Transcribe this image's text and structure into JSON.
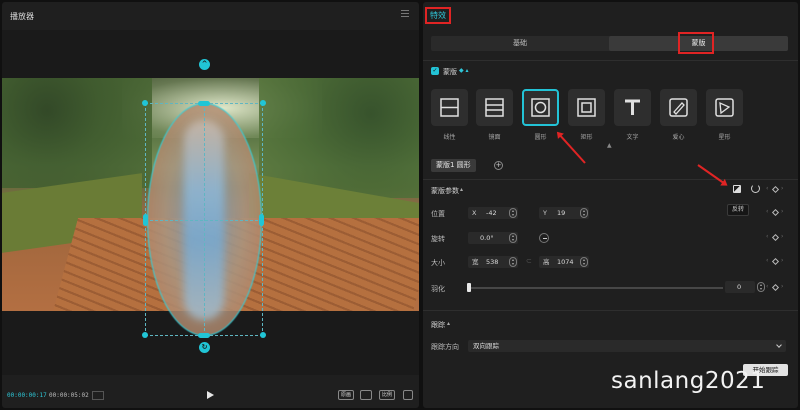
{
  "player": {
    "title": "播放器",
    "current_time": "00:00:00:17",
    "total_time": "00:00:05:02",
    "btn_original": "原画",
    "btn_ratio": "比例"
  },
  "effects": {
    "tab_title": "特效",
    "segment": {
      "basic": "基础",
      "mask": "蒙版"
    },
    "mask_section": "蒙版",
    "shapes": [
      "线性",
      "镜面",
      "圆形",
      "矩形",
      "文字",
      "爱心",
      "星形"
    ],
    "selected_shape": "圆形",
    "mask_chip": "蒙版1 圆形",
    "params_section": "蒙版参数",
    "invert_tooltip": "反转",
    "position": {
      "label": "位置",
      "x_prefix": "X",
      "x_value": "-42",
      "y_prefix": "Y",
      "y_value": "19"
    },
    "rotation": {
      "label": "旋转",
      "value": "0.0°"
    },
    "size": {
      "label": "大小",
      "w_prefix": "宽",
      "w_value": "538",
      "h_prefix": "高",
      "h_value": "1074"
    },
    "feather": {
      "label": "羽化",
      "value": "0"
    },
    "tracking_section": "跟踪",
    "tracking_direction": {
      "label": "跟踪方向",
      "value": "双向跟踪"
    },
    "start_tracking": "开始跟踪"
  },
  "watermark": "sanlang2021",
  "colors": {
    "accent": "#23c3d6",
    "annotation": "#e02424"
  }
}
